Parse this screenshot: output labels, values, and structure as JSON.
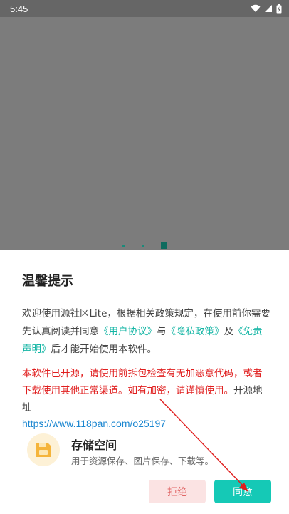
{
  "status_bar": {
    "time": "5:45",
    "icons": [
      "wifi-icon",
      "signal-icon",
      "battery-charging-icon"
    ]
  },
  "pager": {
    "count": 3,
    "active_index": 2
  },
  "dialog": {
    "title": "温馨提示",
    "intro": {
      "part1": "欢迎使用源社区Lite，根据相关政策规定，在使用前你需要先认真阅读并同意",
      "link_user_agreement": "《用户协议》",
      "and1": "与",
      "link_privacy": "《隐私政策》",
      "and2": "及",
      "link_disclaimer": "《免责声明》",
      "part2": "后才能开始使用本软件。"
    },
    "warning": {
      "text": "本软件已开源，请使用前拆包检查有无加恶意代码，或者下载使用其他正常渠道。如有加密，请谨慎使用。",
      "source_label": "开源地址",
      "source_url": "https://www.118pan.com/o25197"
    },
    "permission": {
      "icon": "storage-folder-icon",
      "title": "存储空间",
      "description": "用于资源保存、图片保存、下载等。"
    },
    "buttons": {
      "reject": "拒绝",
      "agree": "同意"
    }
  },
  "colors": {
    "accent": "#15c9b6",
    "link": "#13b5a4",
    "warning": "#e01e1e",
    "url": "#1a86d0",
    "annotation_arrow": "#e01e1e"
  }
}
